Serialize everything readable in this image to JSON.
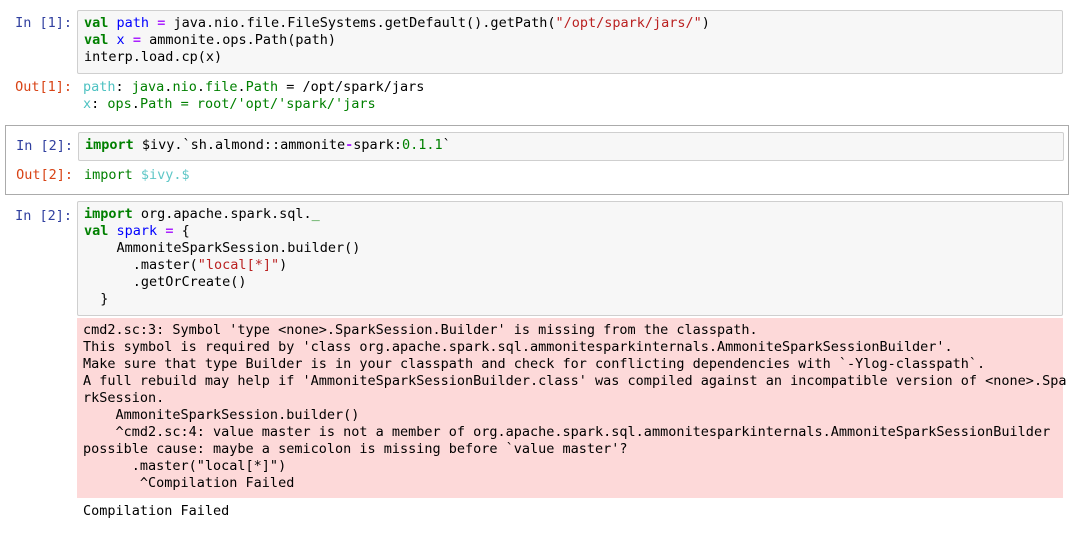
{
  "cells": [
    {
      "in_prompt": "In [1]:",
      "out_prompt": "Out[1]:",
      "code": [
        [
          "val",
          " ",
          "path",
          " ",
          "=",
          " java.nio.file.FileSystems.getDefault().getPath(",
          "\"/opt/spark/jars/\"",
          ")"
        ],
        [
          "val",
          " ",
          "x",
          " ",
          "=",
          " ammonite.ops.Path(path)"
        ],
        [
          "interp.load.cp(x)"
        ]
      ],
      "output": [
        {
          "name": "path",
          "sep": ": ",
          "type_parts": [
            "java",
            ".",
            "nio",
            ".",
            "file",
            ".",
            "Path"
          ],
          "rest": " = /opt/spark/jars"
        },
        {
          "name": "x",
          "sep": ": ",
          "type_parts": [
            "ops",
            ".",
            "Path"
          ],
          "rest": " = root/'opt/'spark/'jars"
        }
      ]
    },
    {
      "in_prompt": "In [2]:",
      "out_prompt": "Out[2]:",
      "code_kw": "import",
      "code_mid": " $ivy.`sh.almond::ammonite",
      "code_dash": "-",
      "code_pkg": "spark:",
      "code_ver": "0.1.1",
      "code_tail": "`",
      "output_import": "import",
      "output_ivy": " $ivy.$"
    },
    {
      "in_prompt": "In [2]:",
      "code_line1_kw": "import",
      "code_line1_rest": " org.apache.spark.sql.",
      "code_line1_us": "_",
      "code_line2_kw": "val",
      "code_line2_var": "spark",
      "code_line2_op": "=",
      "code_line2_rest": " {",
      "code_line3": "    AmmoniteSparkSession.builder()",
      "code_line4_pre": "      .master(",
      "code_line4_str": "\"local[*]\"",
      "code_line4_post": ")",
      "code_line5": "      .getOrCreate()",
      "code_line6": "  }",
      "error_lines": [
        "cmd2.sc:3: Symbol 'type <none>.SparkSession.Builder' is missing from the classpath.",
        "This symbol is required by 'class org.apache.spark.sql.ammonitesparkinternals.AmmoniteSparkSessionBuilder'.",
        "Make sure that type Builder is in your classpath and check for conflicting dependencies with `-Ylog-classpath`.",
        "A full rebuild may help if 'AmmoniteSparkSessionBuilder.class' was compiled against an incompatible version of <none>.Spa",
        "rkSession.",
        "    AmmoniteSparkSession.builder()",
        "    ^cmd2.sc:4: value master is not a member of org.apache.spark.sql.ammonitesparkinternals.AmmoniteSparkSessionBuilder",
        "possible cause: maybe a semicolon is missing before `value master'?",
        "      .master(\"local[*]\")",
        "       ^Compilation Failed"
      ],
      "final_output": "Compilation Failed"
    }
  ]
}
